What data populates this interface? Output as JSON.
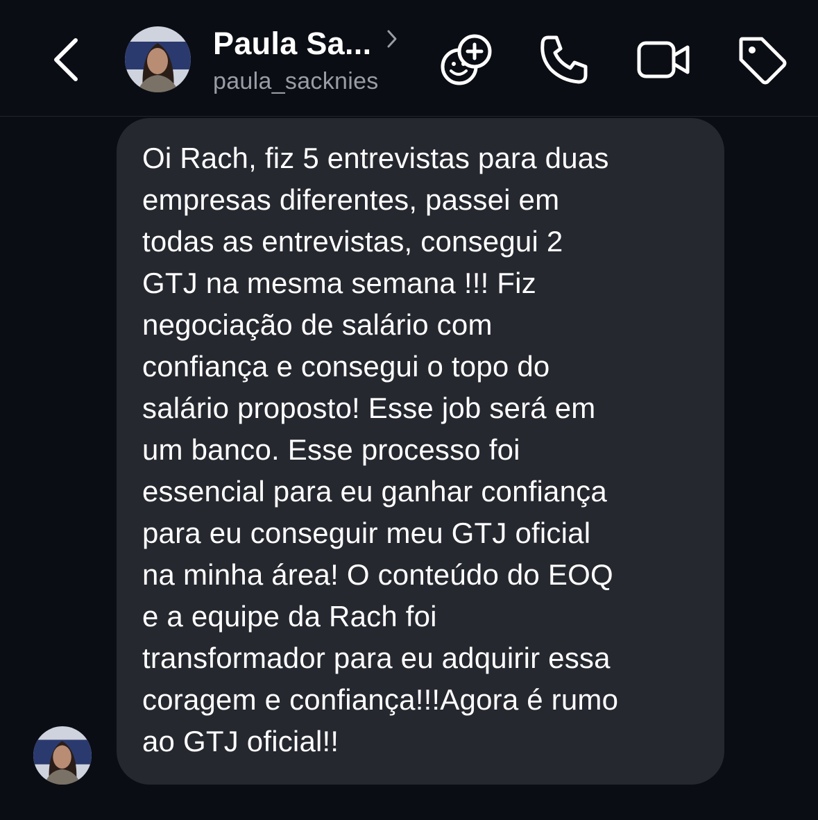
{
  "header": {
    "back_icon": "chevron-left-icon",
    "contact_name": "Paula Sa...",
    "username": "paula_sacknies",
    "actions": [
      {
        "icon": "add-emoji-group-icon"
      },
      {
        "icon": "phone-icon"
      },
      {
        "icon": "video-camera-icon"
      },
      {
        "icon": "tag-icon"
      }
    ]
  },
  "message": {
    "text": "Oi Rach, fiz 5 entrevistas para duas\nempresas diferentes, passei em\ntodas as entrevistas, consegui 2\nGTJ na mesma semana !!! Fiz\nnegociação de salário com\nconfiança e consegui o topo do\nsalário proposto! Esse job será em\num banco. Esse processo foi\nessencial para eu ganhar confiança\npara eu conseguir meu GTJ oficial\nna minha área! O conteúdo do EOQ\ne a equipe da Rach foi\ntransformador para eu adquirir essa\ncoragem e confiança!!!Agora é rumo\nao GTJ oficial!!"
  },
  "colors": {
    "background": "#0b0d14",
    "bubble": "#262830",
    "username": "#9a9ca6"
  }
}
